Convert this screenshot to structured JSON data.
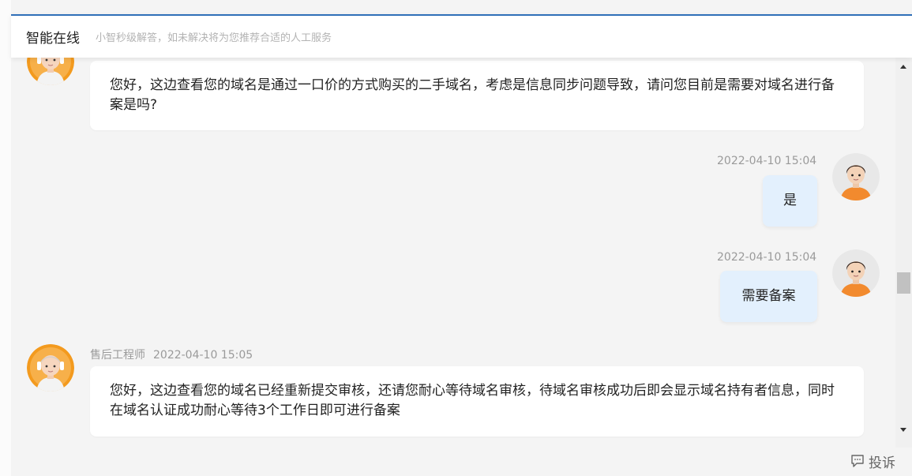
{
  "header": {
    "title": "智能在线",
    "subtitle": "小智秒级解答，如未解决将为您推荐合适的人工服务"
  },
  "messages": [
    {
      "side": "left",
      "text": "您好，这边查看您的域名是通过一口价的方式购买的二手域名，考虑是信息同步问题导致，请问您目前是需要对域名进行备案是吗?"
    },
    {
      "side": "right",
      "time": "2022-04-10 15:04",
      "text": "是"
    },
    {
      "side": "right",
      "time": "2022-04-10 15:04",
      "text": "需要备案"
    },
    {
      "side": "left",
      "sender": "售后工程师",
      "time": "2022-04-10 15:05",
      "text": "您好，这边查看您的域名已经重新提交审核，还请您耐心等待域名审核，待域名审核成功后即会显示域名持有者信息，同时在域名认证成功耐心等待3个工作日即可进行备案"
    }
  ],
  "footer": {
    "complain_label": "投诉"
  },
  "colors": {
    "accent": "#2f6fb8",
    "user_bubble": "#e3f0fd",
    "agent_bubble": "#ffffff",
    "agent_avatar": "#f39a1e",
    "user_shirt": "#f28a2e"
  }
}
